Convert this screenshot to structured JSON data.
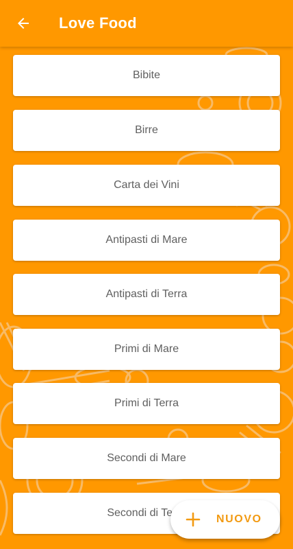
{
  "appbar": {
    "title": "Love Food",
    "back_icon": "arrow-left-icon"
  },
  "categories": [
    {
      "label": "Bibite"
    },
    {
      "label": "Birre"
    },
    {
      "label": "Carta dei Vini"
    },
    {
      "label": "Antipasti di Mare"
    },
    {
      "label": "Antipasti di Terra"
    },
    {
      "label": "Primi di Mare"
    },
    {
      "label": "Primi di Terra"
    },
    {
      "label": "Secondi di Mare"
    },
    {
      "label": "Secondi di Terra"
    }
  ],
  "fab": {
    "label": "NUOVO",
    "icon": "plus-icon"
  },
  "colors": {
    "primary": "#FF9800",
    "accent": "#F29A12",
    "card_text": "#5f5f5f",
    "card_background": "#ffffff"
  }
}
